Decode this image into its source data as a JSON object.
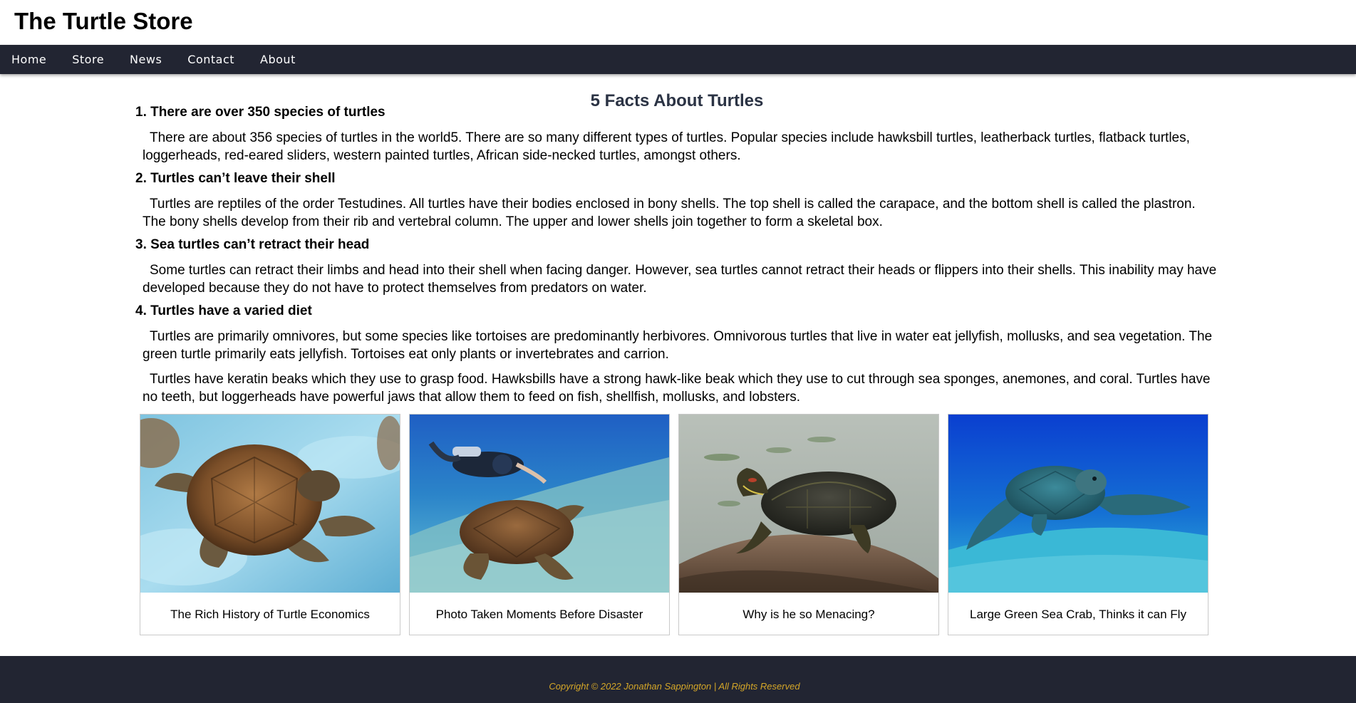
{
  "site": {
    "title": "The Turtle Store"
  },
  "nav": {
    "items": [
      {
        "label": "Home"
      },
      {
        "label": "Store"
      },
      {
        "label": "News"
      },
      {
        "label": "Contact"
      },
      {
        "label": "About"
      }
    ]
  },
  "main": {
    "heading": "5 Facts About Turtles",
    "facts": [
      {
        "title": "1. There are over 350 species of turtles",
        "paragraphs": [
          "There are about 356 species of turtles in the world5. There are so many different types of turtles. Popular species include hawksbill turtles, leatherback turtles, flatback turtles, loggerheads, red-eared sliders, western painted turtles, African side-necked turtles, amongst others."
        ]
      },
      {
        "title": "2. Turtles can’t leave their shell",
        "paragraphs": [
          "Turtles are reptiles of the order Testudines. All turtles have their bodies enclosed in bony shells. The top shell is called the carapace, and the bottom shell is called the plastron. The bony shells develop from their rib and vertebral column. The upper and lower shells join together to form a skeletal box."
        ]
      },
      {
        "title": "3. Sea turtles can’t retract their head",
        "paragraphs": [
          "Some turtles can retract their limbs and head into their shell when facing danger. However, sea turtles cannot retract their heads or flippers into their shells. This inability may have developed because they do not have to protect themselves from predators on water."
        ]
      },
      {
        "title": "4. Turtles have a varied diet",
        "paragraphs": [
          "Turtles are primarily omnivores, but some species like tortoises are predominantly herbivores. Omnivorous turtles that live in water eat jellyfish, mollusks, and sea vegetation. The green turtle primarily eats jellyfish. Tortoises eat only plants or invertebrates and carrion.",
          "Turtles have keratin beaks which they use to grasp food. Hawksbills have a strong hawk-like beak which they use to cut through sea sponges, anemones, and coral. Turtles have no teeth, but loggerheads have powerful jaws that allow them to feed on fish, shellfish, mollusks, and lobsters."
        ]
      }
    ]
  },
  "gallery": {
    "cards": [
      {
        "caption": "The Rich History of Turtle Economics",
        "image": "turtle-swimming-photo"
      },
      {
        "caption": "Photo Taken Moments Before Disaster",
        "image": "diver-and-turtle-photo"
      },
      {
        "caption": "Why is he so Menacing?",
        "image": "slider-turtle-on-rock-photo"
      },
      {
        "caption": "Large Green Sea Crab, Thinks it can Fly",
        "image": "sea-turtle-underwater-photo"
      }
    ]
  },
  "footer": {
    "copyright": "Copyright © 2022 Jonathan Sappington | All Rights Reserved"
  },
  "colors": {
    "navbar_bg": "#222532",
    "heading": "#2b3344",
    "footer_text": "#d4a628"
  }
}
